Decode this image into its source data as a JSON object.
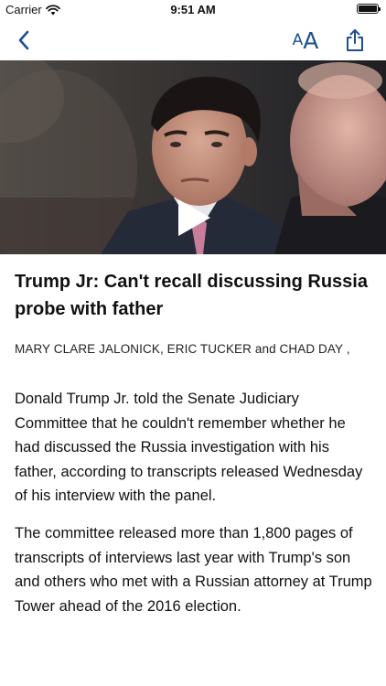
{
  "status_bar": {
    "carrier": "Carrier",
    "time": "9:51 AM",
    "battery_level": 1.0
  },
  "nav": {
    "back_icon": "chevron-left-icon",
    "text_size": {
      "small": "A",
      "large": "A"
    },
    "share_icon": "share-icon",
    "accent_color": "#1d4f91"
  },
  "hero": {
    "play_icon": "play-icon"
  },
  "article": {
    "headline": "Trump Jr: Can't recall discussing Russia probe with father",
    "byline": "MARY CLARE JALONICK, ERIC TUCKER and CHAD DAY ,",
    "paragraphs": [
      "Donald Trump Jr. told the Senate Judiciary Committee that he couldn't remember whether he had discussed the Russia investigation with his father, according to transcripts released Wednesday of his interview with the panel.",
      "The committee released more than 1,800 pages of transcripts of interviews last year with Trump's son and others who met with a Russian attorney at Trump Tower ahead of the 2016 election."
    ]
  }
}
